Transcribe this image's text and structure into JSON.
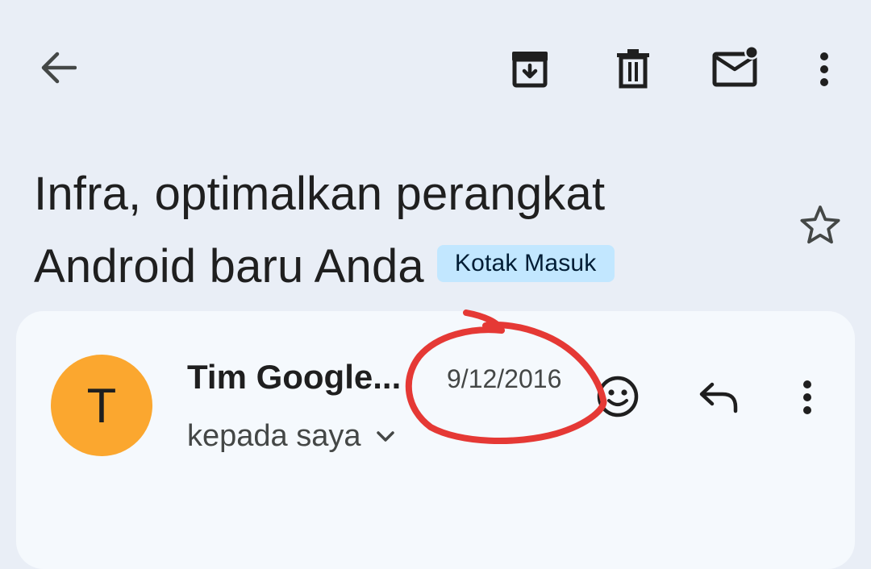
{
  "toolbar": {
    "back_icon": "arrow-left-icon",
    "archive_icon": "archive-icon",
    "delete_icon": "trash-icon",
    "mark_unread_icon": "mark-unread-icon",
    "more_icon": "more-vert-icon"
  },
  "email": {
    "subject_line1": "Infra, optimalkan perangkat",
    "subject_line2": "Android baru Anda",
    "label": "Kotak Masuk",
    "star_icon": "star-outline-icon"
  },
  "message": {
    "avatar_letter": "T",
    "avatar_color": "#fba72f",
    "sender": "Tim Google...",
    "date": "9/12/2016",
    "recipient": "kepada saya",
    "emoji_icon": "emoji-icon",
    "reply_icon": "reply-icon",
    "more_icon": "more-vert-icon"
  },
  "colors": {
    "background": "#e9eef6",
    "card": "#f5f9fd",
    "chip": "#c2e7ff",
    "annotation": "#e53935"
  }
}
